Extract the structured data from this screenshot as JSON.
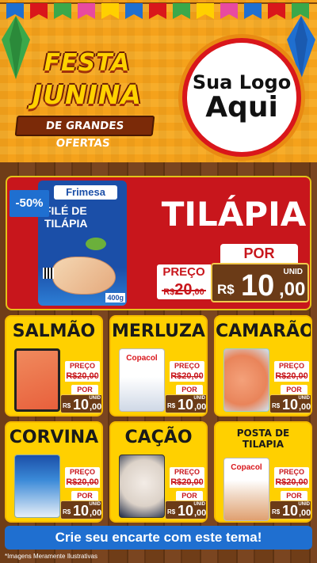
{
  "header": {
    "title_line1": "FESTA",
    "title_line2": "JUNINA",
    "subtitle": "DE GRANDES OFERTAS",
    "logo_line1": "Sua Logo",
    "logo_line2": "Aqui"
  },
  "hero": {
    "discount": "-50%",
    "brand": "Frimesa",
    "package_name": "FILÉ DE TILÁPIA",
    "package_weight": "400g",
    "title": "TILÁPIA",
    "por_label": "POR",
    "preco_label": "PREÇO",
    "old_currency": "R$",
    "old_int": "20",
    "old_dec": ",00",
    "currency": "R$",
    "price_int": "10",
    "price_dec": ",00",
    "unit": "UNID"
  },
  "products": [
    {
      "name": "SALMÃO",
      "preco_label": "PREÇO",
      "old": "R$20,00",
      "por_label": "POR",
      "currency": "R$",
      "int": "10",
      "dec": ",00",
      "unit": "UNID"
    },
    {
      "name": "MERLUZA",
      "brand": "Copacol",
      "preco_label": "PREÇO",
      "old": "R$20,00",
      "por_label": "POR",
      "currency": "R$",
      "int": "10",
      "dec": ",00",
      "unit": "UNID"
    },
    {
      "name": "CAMARÃO",
      "preco_label": "PREÇO",
      "old": "R$20,00",
      "por_label": "POR",
      "currency": "R$",
      "int": "10",
      "dec": ",00",
      "unit": "UNID"
    },
    {
      "name": "CORVINA",
      "preco_label": "PREÇO",
      "old": "R$20,00",
      "por_label": "POR",
      "currency": "R$",
      "int": "10",
      "dec": ",00",
      "unit": "UNID"
    },
    {
      "name": "CAÇÃO",
      "preco_label": "PREÇO",
      "old": "R$20,00",
      "por_label": "POR",
      "currency": "R$",
      "int": "10",
      "dec": ",00",
      "unit": "UNID"
    },
    {
      "name": "POSTA DE TILAPIA",
      "brand": "Copacol",
      "preco_label": "PREÇO",
      "old": "R$20,00",
      "por_label": "POR",
      "currency": "R$",
      "int": "10",
      "dec": ",00",
      "unit": "UNID"
    }
  ],
  "cta": "Crie seu encarte com este tema!",
  "disclaimer": "*Imagens Meramente Ilustrativas",
  "colors": {
    "accent_red": "#c8161c",
    "card_yellow": "#ffd000",
    "wood_brown": "#6b3b17",
    "cta_blue": "#1f6fd0",
    "header_orange": "#f5a21b"
  }
}
